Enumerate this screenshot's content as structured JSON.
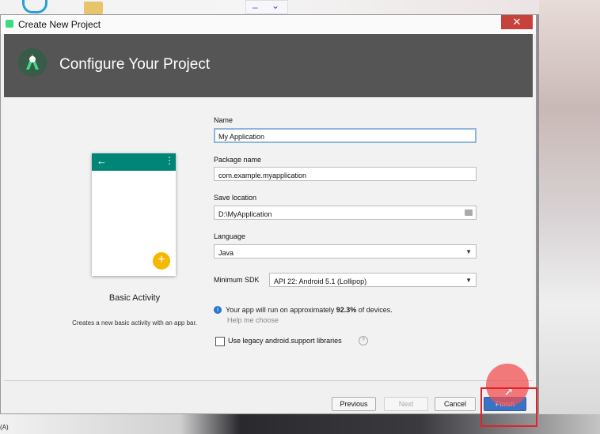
{
  "window": {
    "title": "Create New Project",
    "close_symbol": "✕"
  },
  "header": {
    "title": "Configure Your Project"
  },
  "activity": {
    "name": "Basic Activity",
    "description": "Creates a new basic activity with an app bar."
  },
  "form": {
    "name_label": "Name",
    "name_value": "My Application",
    "package_label": "Package name",
    "package_value": "com.example.myapplication",
    "save_label": "Save location",
    "save_value": "D:\\MyApplication",
    "language_label": "Language",
    "language_value": "Java",
    "min_sdk_label": "Minimum SDK",
    "min_sdk_value": "API 22: Android 5.1 (Lollipop)",
    "info_prefix": "Your app will run on approximately ",
    "info_percent": "92.3%",
    "info_suffix": " of devices.",
    "help_link": "Help me choose",
    "legacy_label": "Use legacy android.support libraries"
  },
  "buttons": {
    "previous": "Previous",
    "next": "Next",
    "cancel": "Cancel",
    "finish": "Finish"
  },
  "desktop": {
    "bottom_label": "(A)"
  },
  "colors": {
    "header_bg": "#555555",
    "appbar_teal": "#008577",
    "fab_yellow": "#f5b800",
    "finish_blue": "#3b72c4",
    "highlight_red": "#e0232b"
  }
}
